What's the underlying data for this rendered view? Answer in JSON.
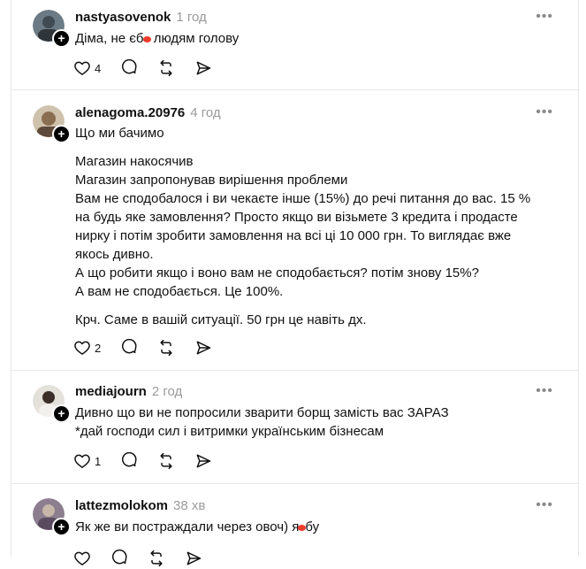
{
  "posts": [
    {
      "username": "nastyasovenok",
      "time": "1 год",
      "lines": [
        "Діма, не єбу людям голову"
      ],
      "likes": "4",
      "avatar_color": "#6b7a85"
    },
    {
      "username": "alenagoma.20976",
      "time": "4 год",
      "lines": [
        "Що ми бачимо",
        "",
        "Магазин накосячив",
        "Магазин запропонував вирішення проблеми",
        "Вам не сподобалося і ви чекаєте інше (15%) до речі питання до вас. 15 %",
        "на будь яке замовлення? Просто якщо ви візьмете 3 кредита і продасте",
        "нирку і потім зробити замовлення на всі ці 10 000 грн. То виглядає вже",
        "якось дивно.",
        "А що робити якщо і воно вам не сподобається? потім знову 15%?",
        "А вам не сподобається. Це 100%.",
        "",
        "Крч. Саме в вашій ситуації. 50 грн це навіть дх."
      ],
      "likes": "2",
      "avatar_color": "#a08d73"
    },
    {
      "username": "mediajourn",
      "time": "2 год",
      "lines": [
        "Дивно що ви не попросили зварити борщ замість вас ЗАРАЗ",
        "*дай господи сил і витримки українським бізнесам"
      ],
      "likes": "1",
      "avatar_color": "#c9c4bd"
    },
    {
      "username": "lattezmolokom",
      "time": "38 хв",
      "lines": [
        "Як же ви постраждали через овоч) ябу"
      ],
      "likes": "",
      "avatar_color": "#8c7d8f"
    }
  ],
  "icons": {
    "like": "heart-icon",
    "comment": "comment-icon",
    "repost": "repost-icon",
    "share": "share-icon",
    "more": "more-options-icon",
    "follow": "follow-plus-icon"
  },
  "more_label": "•••",
  "plus_label": "+"
}
